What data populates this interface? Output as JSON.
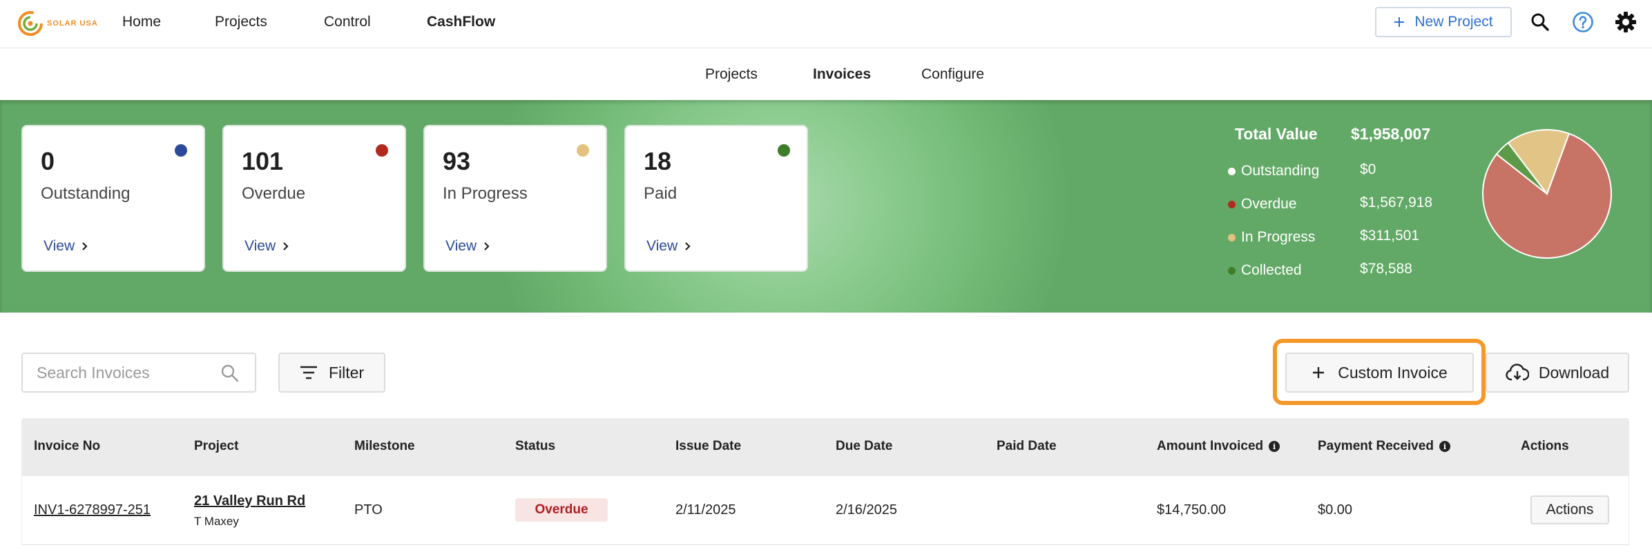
{
  "brand": {
    "logo_text": "SOLAR USA",
    "accent": "#f28b24"
  },
  "nav": {
    "items": [
      {
        "label": "Home"
      },
      {
        "label": "Projects"
      },
      {
        "label": "Control"
      },
      {
        "label": "CashFlow"
      }
    ],
    "active": "CashFlow"
  },
  "header": {
    "new_project_label": "New Project",
    "icons": [
      "search-icon",
      "help-icon",
      "gear-icon"
    ]
  },
  "subnav": {
    "items": [
      {
        "label": "Projects"
      },
      {
        "label": "Invoices"
      },
      {
        "label": "Configure"
      }
    ],
    "active": "Invoices"
  },
  "summary_cards": [
    {
      "count": "0",
      "label": "Outstanding",
      "view": "View",
      "dot_color": "#2c4a9a"
    },
    {
      "count": "101",
      "label": "Overdue",
      "view": "View",
      "dot_color": "#b22a1f"
    },
    {
      "count": "93",
      "label": "In Progress",
      "view": "View",
      "dot_color": "#e2c27e"
    },
    {
      "count": "18",
      "label": "Paid",
      "view": "View",
      "dot_color": "#3e7d2a"
    }
  ],
  "totals": {
    "label": "Total Value",
    "value": "$1,958,007",
    "legend": [
      {
        "label": "Outstanding",
        "value": "$0",
        "color": "#ffffff"
      },
      {
        "label": "Overdue",
        "value": "$1,567,918",
        "color": "#b22a1f"
      },
      {
        "label": "In Progress",
        "value": "$311,501",
        "color": "#e2c27e"
      },
      {
        "label": "Collected",
        "value": "$78,588",
        "color": "#3e7d2a"
      }
    ]
  },
  "chart_data": {
    "type": "pie",
    "categories": [
      "Outstanding",
      "Overdue",
      "In Progress",
      "Collected"
    ],
    "values": [
      0,
      1567918,
      311501,
      78588
    ],
    "colors": [
      "#ffffff",
      "#c77466",
      "#e2c586",
      "#5c9a48"
    ]
  },
  "toolbar": {
    "search_placeholder": "Search Invoices",
    "filter_label": "Filter",
    "custom_invoice_label": "Custom Invoice",
    "download_label": "Download"
  },
  "table": {
    "columns": [
      "Invoice No",
      "Project",
      "Milestone",
      "Status",
      "Issue Date",
      "Due Date",
      "Paid Date",
      "Amount Invoiced",
      "Payment Received",
      "Actions"
    ],
    "rows": [
      {
        "invoice_no": "INV1-6278997-251",
        "project": "21 Valley Run Rd",
        "customer": "T Maxey",
        "milestone": "PTO",
        "status": "Overdue",
        "issue_date": "2/11/2025",
        "due_date": "2/16/2025",
        "paid_date": "",
        "amount_invoiced": "$14,750.00",
        "payment_received": "$0.00",
        "actions_label": "Actions"
      }
    ]
  }
}
